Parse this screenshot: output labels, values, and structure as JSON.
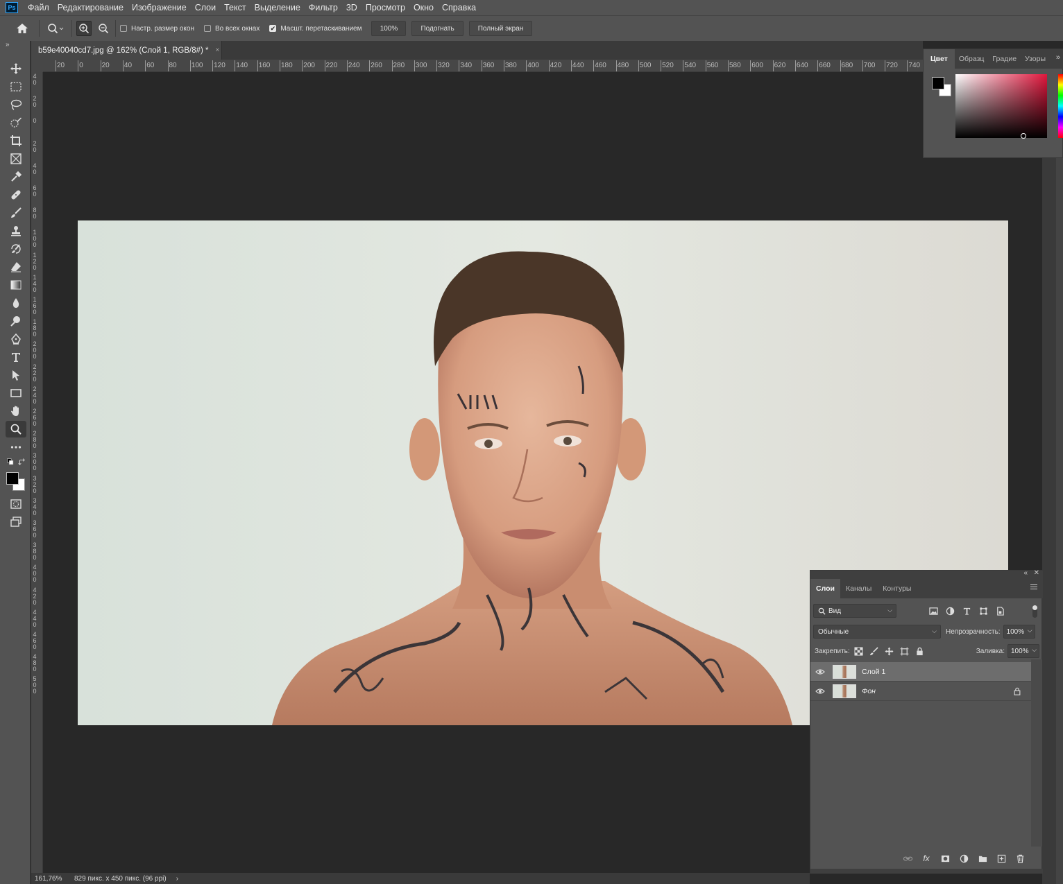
{
  "app": {
    "logo_text": "Ps"
  },
  "menu": [
    "Файл",
    "Редактирование",
    "Изображение",
    "Слои",
    "Текст",
    "Выделение",
    "Фильтр",
    "3D",
    "Просмотр",
    "Окно",
    "Справка"
  ],
  "options": {
    "resize_windows": "Настр. размер окон",
    "all_windows": "Во всех окнах",
    "scrubby_zoom": "Масшт. перетаскиванием",
    "zoom_100": "100%",
    "fit_screen": "Подогнать",
    "fill_screen": "Полный экран",
    "resize_windows_checked": false,
    "all_windows_checked": false,
    "scrubby_zoom_checked": true
  },
  "document": {
    "tab_title": "b59e40040cd7.jpg @ 162% (Слой 1, RGB/8#) *",
    "close_glyph": "×"
  },
  "rulers": {
    "top": [
      "20",
      "0",
      "20",
      "40",
      "60",
      "80",
      "100",
      "120",
      "140",
      "160",
      "180",
      "200",
      "220",
      "240",
      "260",
      "280",
      "300",
      "320",
      "340",
      "360",
      "380",
      "400",
      "420",
      "440",
      "460",
      "480",
      "500",
      "520",
      "540",
      "560",
      "580",
      "600",
      "620",
      "640",
      "660",
      "680",
      "700",
      "720",
      "740"
    ],
    "left": [
      "40",
      "20",
      "0",
      "20",
      "40",
      "60",
      "80",
      "100",
      "120",
      "140",
      "160",
      "180",
      "200",
      "220",
      "240",
      "260",
      "280",
      "300",
      "320",
      "340",
      "360",
      "380",
      "400",
      "420",
      "440",
      "460",
      "480",
      "500"
    ]
  },
  "status": {
    "zoom": "161,76%",
    "doc_info": "829 пикс. x 450 пикс. (96 ppi)",
    "arrow": "›"
  },
  "color_panel": {
    "tabs": [
      "Цвет",
      "Образц",
      "Градие",
      "Узоры"
    ],
    "active_tab": 0,
    "foreground": "#000000",
    "background": "#ffffff",
    "hue_color": "#e0163c"
  },
  "layers_panel": {
    "tabs": [
      "Слои",
      "Каналы",
      "Контуры"
    ],
    "active_tab": 0,
    "filter_kind": "Вид",
    "blend_mode": "Обычные",
    "opacity_label": "Непрозрачность:",
    "opacity_value": "100%",
    "lock_label": "Закрепить:",
    "fill_label": "Заливка:",
    "fill_value": "100%",
    "layers": [
      {
        "name": "Слой 1",
        "visible": true,
        "selected": true,
        "locked": false
      },
      {
        "name": "Фон",
        "visible": true,
        "selected": false,
        "locked": true
      }
    ],
    "footer_fx": "fx"
  }
}
